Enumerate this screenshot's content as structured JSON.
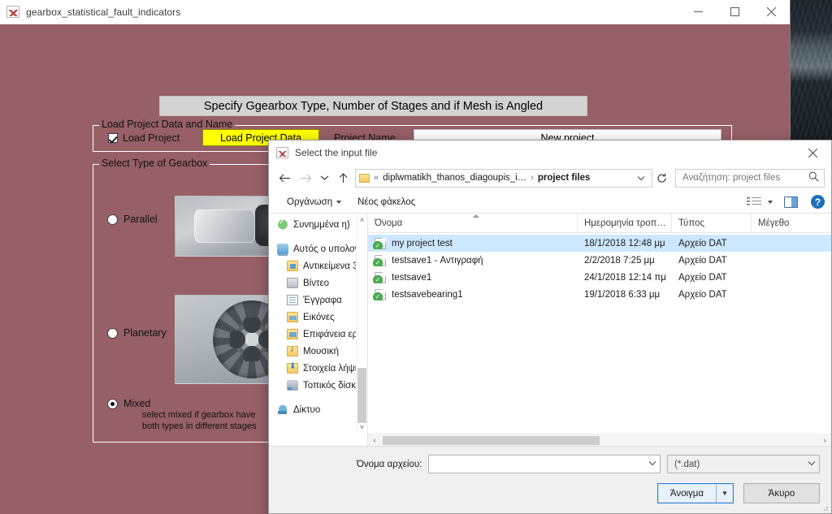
{
  "app": {
    "title": "gearbox_statistical_fault_indicators",
    "icon": "matlab-icon",
    "window_controls": {
      "minimize": "minimize-icon",
      "maximize": "maximize-icon",
      "close": "close-icon"
    },
    "header_banner": "Specify Ggearbox Type, Number of Stages and if Mesh is Angled",
    "background_color": "#966066",
    "load_panel": {
      "title": "Load Project Data and Name",
      "checkbox_label": "Load Project",
      "checkbox_checked": true,
      "button_label": "Load Project Data",
      "button_color": "#ffff00",
      "project_name_label": "Project Name",
      "project_name_value": "New project"
    },
    "type_panel": {
      "title": "Select Type of Gearbox",
      "options": [
        {
          "label": "Parallel",
          "selected": false
        },
        {
          "label": "Planetary",
          "selected": false
        },
        {
          "label": "Mixed",
          "selected": true
        }
      ],
      "hint_line1": "select mixed if gearbox have",
      "hint_line2": "both types in different stages"
    }
  },
  "dialog": {
    "title": "Select the input file",
    "icon": "matlab-icon",
    "close_label": "close-icon",
    "nav": {
      "back": "back-arrow-icon",
      "forward": "forward-arrow-icon",
      "recent": "recent-locations-icon",
      "up": "up-arrow-icon"
    },
    "address": {
      "folder_icon": "folder-icon",
      "prefix": "«",
      "parent": "diplwmatikh_thanos_diagoupis_i…",
      "separator": "›",
      "current": "project files",
      "dropdown": "chevron-down-icon",
      "refresh": "refresh-icon"
    },
    "search": {
      "placeholder": "Αναζήτηση: project files",
      "value": "",
      "icon": "search-icon"
    },
    "toolbar": {
      "organize": "Οργάνωση",
      "new_folder": "Νέος φάκελος",
      "view_icon": "view-options-icon",
      "preview_icon": "preview-pane-icon",
      "help_icon": "help-icon",
      "help_glyph": "?"
    },
    "sidebar": [
      {
        "label": "Συνημμένα η)",
        "icon": "onedrive-icon",
        "indent": false,
        "gap": false
      },
      {
        "label": "Αυτός ο υπολογ",
        "icon": "this-pc-icon",
        "indent": false,
        "gap": true
      },
      {
        "label": "Αντικείμενα 3",
        "icon": "folder-3d-objects-icon",
        "indent": true,
        "gap": false
      },
      {
        "label": "Βίντεο",
        "icon": "folder-videos-icon",
        "indent": true,
        "gap": false
      },
      {
        "label": "Έγγραφα",
        "icon": "folder-documents-icon",
        "indent": true,
        "gap": false
      },
      {
        "label": "Εικόνες",
        "icon": "folder-pictures-icon",
        "indent": true,
        "gap": false
      },
      {
        "label": "Επιφάνεια εργ",
        "icon": "folder-desktop-icon",
        "indent": true,
        "gap": false
      },
      {
        "label": "Μουσική",
        "icon": "folder-music-icon",
        "indent": true,
        "gap": false
      },
      {
        "label": "Στοιχεία λήψη",
        "icon": "folder-downloads-icon",
        "indent": true,
        "gap": false
      },
      {
        "label": "Τοπικός δίσκο",
        "icon": "local-disk-icon",
        "indent": true,
        "gap": false
      },
      {
        "label": "Δίκτυο",
        "icon": "network-icon",
        "indent": false,
        "gap": true
      }
    ],
    "columns": [
      {
        "label": "Όνομα",
        "sorted": "asc"
      },
      {
        "label": "Ημερομηνία τροπ…",
        "sorted": ""
      },
      {
        "label": "Τύπος",
        "sorted": ""
      },
      {
        "label": "Μέγεθο",
        "sorted": ""
      }
    ],
    "files": [
      {
        "name": "my project test",
        "date": "18/1/2018 12:48 μμ",
        "type": "Αρχείο DAT",
        "size": "",
        "icon": "dat-file-icon",
        "selected": true
      },
      {
        "name": "testsave1 - Αντιγραφή",
        "date": "2/2/2018 7:25 μμ",
        "type": "Αρχείο DAT",
        "size": "",
        "icon": "dat-file-icon",
        "selected": false
      },
      {
        "name": "testsave1",
        "date": "24/1/2018 12:14 πμ",
        "type": "Αρχείο DAT",
        "size": "",
        "icon": "dat-file-icon",
        "selected": false
      },
      {
        "name": "testsavebearing1",
        "date": "19/1/2018 6:33 μμ",
        "type": "Αρχείο DAT",
        "size": "",
        "icon": "dat-file-icon",
        "selected": false
      }
    ],
    "bottom": {
      "filename_label": "Όνομα αρχείου:",
      "filename_value": "",
      "filter_value": "(*.dat)",
      "open_label": "Άνοιγμα",
      "cancel_label": "Άκυρο"
    }
  }
}
